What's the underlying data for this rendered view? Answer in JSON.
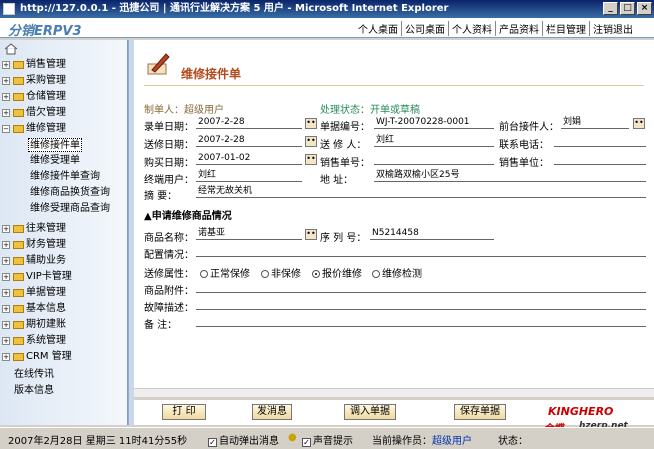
{
  "window": {
    "title": "http://127.0.0.1 - 迅捷公司 | 通讯行业解决方案 5 用户 - Microsoft Internet Explorer"
  },
  "app": {
    "logo": "分销ERPV3"
  },
  "topnav": [
    "个人桌面",
    "公司桌面",
    "个人资料",
    "产品资料",
    "栏目管理",
    "注销退出"
  ],
  "sidebar": {
    "folders": [
      "销售管理",
      "采购管理",
      "仓储管理",
      "借欠管理",
      "维修管理"
    ],
    "subitems": [
      "维修接件单",
      "维修受理单",
      "维修接件单查询",
      "维修商品换货查询",
      "维修受理商品查询"
    ],
    "folders2": [
      "往来管理",
      "财务管理",
      "辅助业务",
      "VIP卡管理",
      "单据管理",
      "基本信息",
      "期初建账",
      "系统管理",
      "CRM 管理"
    ],
    "extra": [
      "在线传讯",
      "版本信息"
    ]
  },
  "form": {
    "title": "维修接件单",
    "maker_label": "制单人：",
    "maker_value": "超级用户",
    "status_label": "处理状态：",
    "status_value": "开单或草稿",
    "fields": {
      "record_date_label": "录单日期：",
      "record_date": "2007-2-28",
      "doc_no_label": "单据编号：",
      "doc_no": "WJ-T-20070228-0001",
      "receiver_label": "前台接件人：",
      "receiver": "刘娟",
      "send_date_label": "送修日期：",
      "send_date": "2007-2-28",
      "sender_label": "送 修 人：",
      "sender": "刘红",
      "phone_label": "联系电话：",
      "phone": "",
      "buy_date_label": "购买日期：",
      "buy_date": "2007-01-02",
      "sale_no_label": "销售单号：",
      "sale_no": "",
      "sale_unit_label": "销售单位：",
      "sale_unit": "",
      "end_user_label": "终端用户：",
      "end_user": "刘红",
      "address_label": "地    址：",
      "address": "双榆路双榆小区25号",
      "summary_label": "摘    要：",
      "summary": "经常无故关机"
    },
    "section_title": "▲申请维修商品情况",
    "product_name_label": "商品名称：",
    "product_name": "诺基亚",
    "serial_label": "序 列 号：",
    "serial": "N5214458",
    "config_label": "配置情况：",
    "attr_label": "送修属性：",
    "attr_options": [
      "正常保修",
      "非保修",
      "报价维修",
      "维修检测"
    ],
    "attr_selected": "报价维修",
    "accessories_label": "商品附件：",
    "fault_label": "故障描述：",
    "remark_label": "备    注："
  },
  "buttons": {
    "print": "打 印",
    "send": "发消息",
    "import": "调入单据",
    "save": "保存单据"
  },
  "brand": {
    "line1": "KINGHERO",
    "line2": "金蝶",
    "line3": "hzerp.net"
  },
  "status": {
    "datetime": "2007年2月28日 星期三 11时41分55秒",
    "popup": "自动弹出消息",
    "sound": "声音提示",
    "operator_label": "当前操作员：",
    "operator": "超级用户",
    "state_label": "状态："
  }
}
